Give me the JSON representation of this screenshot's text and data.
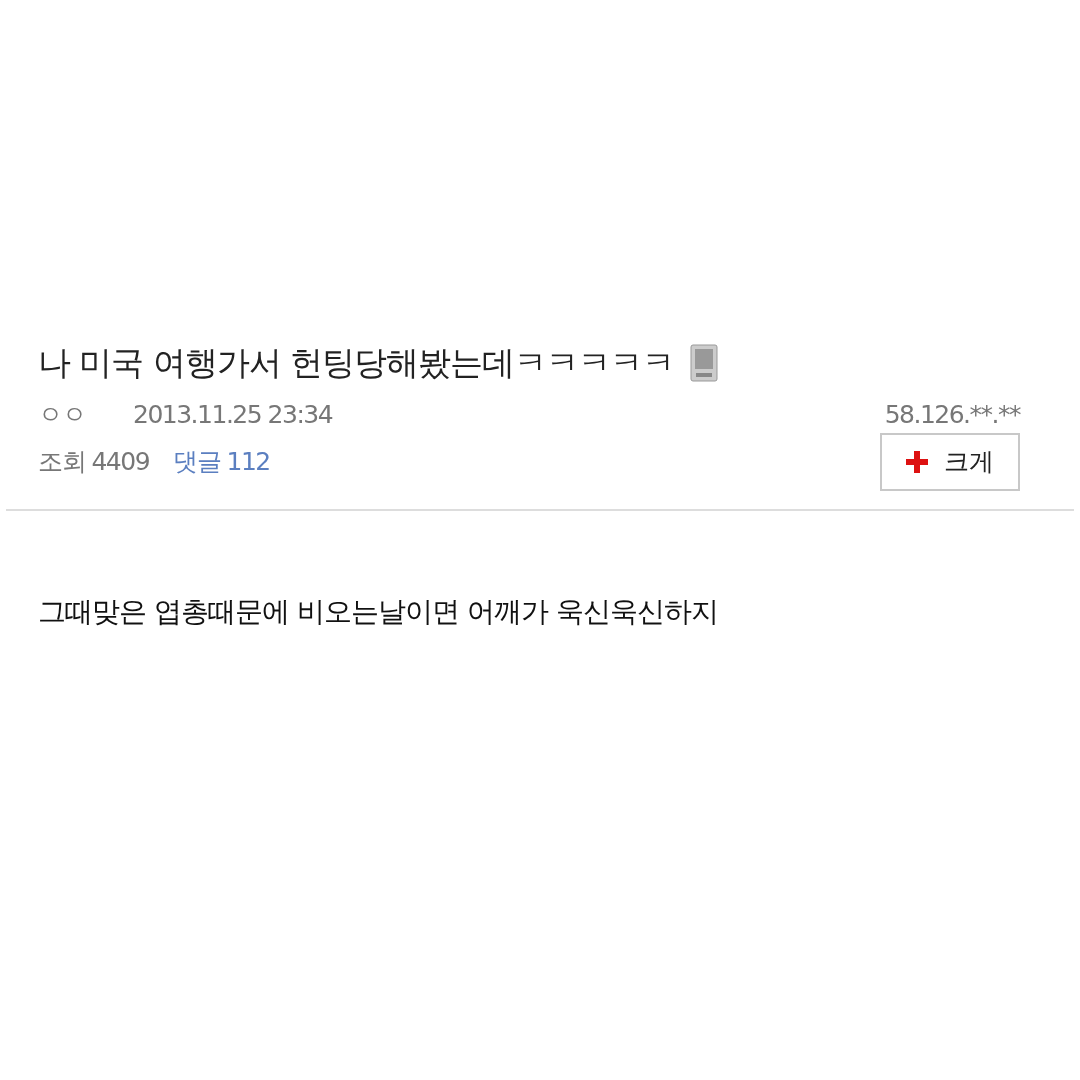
{
  "post": {
    "title": "나 미국 여행가서 헌팅당해봤는데ㅋㅋㅋㅋㅋ",
    "author": "ㅇㅇ",
    "datetime": "2013.11.25 23:34",
    "ip": "58.126.**.**",
    "views_label": "조회",
    "views": "4409",
    "comments_label": "댓글",
    "comments": "112",
    "enlarge_button": "크게",
    "body": "그때맞은 엽총때문에 비오는날이면 어깨가 욱신욱신하지"
  }
}
